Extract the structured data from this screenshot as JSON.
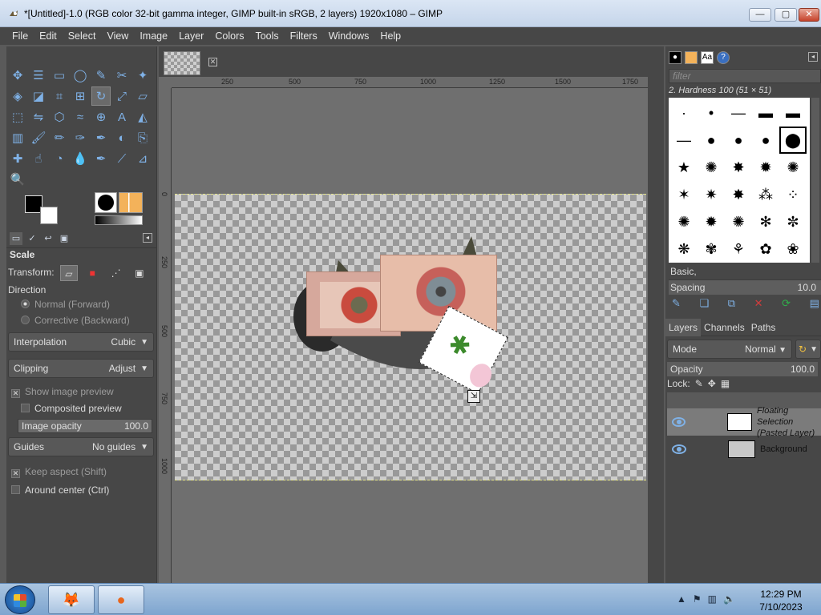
{
  "window": {
    "title": "*[Untitled]-1.0 (RGB color 32-bit gamma integer, GIMP built-in sRGB, 2 layers) 1920x1080 – GIMP",
    "minimize": "—",
    "maximize": "▢",
    "close": "✕"
  },
  "menu": [
    "File",
    "Edit",
    "Select",
    "View",
    "Image",
    "Layer",
    "Colors",
    "Tools",
    "Filters",
    "Windows",
    "Help"
  ],
  "toolbox": {
    "tools": [
      "move-icon",
      "align-icon",
      "rect-select-icon",
      "ellipse-select-icon",
      "free-select-icon",
      "scissors-icon",
      "fuzzy-select-icon",
      "by-color-select-icon",
      "foreground-select-icon",
      "crop-icon",
      "unified-transform-icon",
      "rotate-icon",
      "scale-icon",
      "shear-icon",
      "perspective-icon",
      "flip-icon",
      "cage-icon",
      "warp-icon",
      "handle-transform-icon",
      "text-icon",
      "bucket-fill-icon",
      "gradient-icon",
      "paintbrush-icon",
      "pencil-icon",
      "airbrush-icon",
      "ink-icon",
      "mypaint-icon",
      "clone-icon",
      "heal-icon",
      "smudge-icon",
      "dodge-icon",
      "blur-icon",
      "paths-icon",
      "color-picker-icon",
      "measure-icon",
      "zoom-icon"
    ],
    "active_tool_index": 11
  },
  "tool_options": {
    "title": "Scale",
    "transform_label": "Transform:",
    "direction_label": "Direction",
    "direction_normal": "Normal (Forward)",
    "direction_corrective": "Corrective (Backward)",
    "interpolation_label": "Interpolation",
    "interpolation_value": "Cubic",
    "clipping_label": "Clipping",
    "clipping_value": "Adjust",
    "show_preview": "Show image preview",
    "composited_preview": "Composited preview",
    "image_opacity_label": "Image opacity",
    "image_opacity_value": "100.0",
    "guides_label": "Guides",
    "guides_value": "No guides",
    "keep_aspect": "Keep aspect (Shift)",
    "around_center": "Around center (Ctrl)"
  },
  "ruler": {
    "h_ticks": [
      "250",
      "500",
      "750",
      "1000",
      "1250",
      "1500",
      "1750"
    ],
    "v_ticks": [
      "0",
      "250",
      "500",
      "750",
      "1000"
    ]
  },
  "brushes": {
    "filter_placeholder": "filter",
    "selected_name": "2. Hardness 100 (51 × 51)",
    "category": "Basic,",
    "spacing_label": "Spacing",
    "spacing_value": "10.0"
  },
  "layers": {
    "tabs": [
      "Layers",
      "Channels",
      "Paths"
    ],
    "mode_label": "Mode",
    "mode_value": "Normal",
    "opacity_label": "Opacity",
    "opacity_value": "100.0",
    "lock_label": "Lock:",
    "items": [
      {
        "name": "Floating Selection",
        "sub": "(Pasted Layer)",
        "selected": true
      },
      {
        "name": "Background",
        "sub": "",
        "selected": false
      }
    ]
  },
  "taskbar": {
    "time": "12:29 PM",
    "date": "7/10/2023",
    "apps": [
      "gimp-icon",
      "firefox-icon"
    ]
  }
}
